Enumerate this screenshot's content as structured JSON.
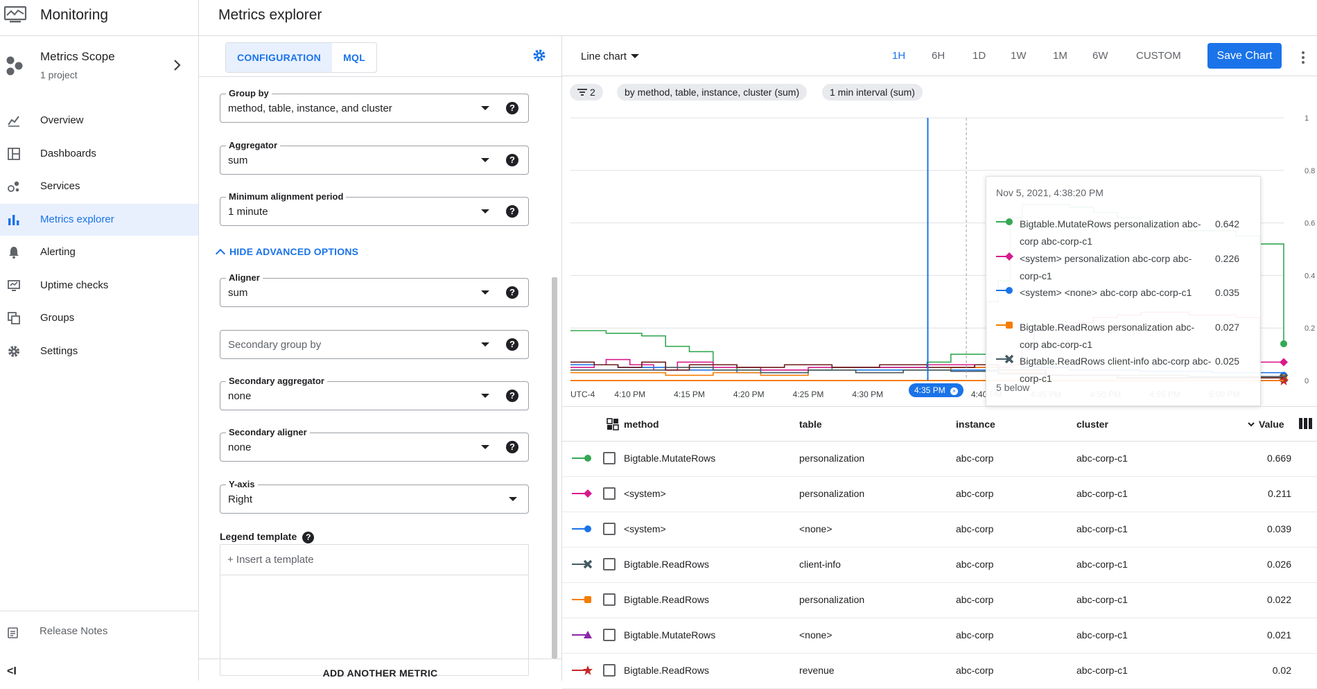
{
  "app": {
    "title": "Monitoring",
    "page_title": "Metrics explorer"
  },
  "scope": {
    "title": "Metrics Scope",
    "subtitle": "1 project"
  },
  "nav": {
    "items": [
      {
        "label": "Overview",
        "icon": "overview-icon"
      },
      {
        "label": "Dashboards",
        "icon": "dashboards-icon"
      },
      {
        "label": "Services",
        "icon": "services-icon"
      },
      {
        "label": "Metrics explorer",
        "icon": "metrics-explorer-icon",
        "active": true
      },
      {
        "label": "Alerting",
        "icon": "bell-icon"
      },
      {
        "label": "Uptime checks",
        "icon": "monitor-icon"
      },
      {
        "label": "Groups",
        "icon": "groups-icon"
      },
      {
        "label": "Settings",
        "icon": "gear-icon"
      }
    ],
    "release_notes": "Release Notes",
    "collapse": "<I"
  },
  "config": {
    "tabs": [
      {
        "label": "CONFIGURATION",
        "active": true
      },
      {
        "label": "MQL"
      }
    ],
    "group_by": {
      "label": "Group by",
      "value": "method, table, instance, and cluster"
    },
    "aggregator": {
      "label": "Aggregator",
      "value": "sum"
    },
    "min_alignment": {
      "label": "Minimum alignment period",
      "value": "1 minute"
    },
    "hide_advanced": "HIDE ADVANCED OPTIONS",
    "aligner": {
      "label": "Aligner",
      "value": "sum"
    },
    "secondary_group_by": {
      "placeholder": "Secondary group by"
    },
    "secondary_aggregator": {
      "label": "Secondary aggregator",
      "value": "none"
    },
    "secondary_aligner": {
      "label": "Secondary aligner",
      "value": "none"
    },
    "y_axis": {
      "label": "Y-axis",
      "value": "Right"
    },
    "legend_template": {
      "label": "Legend template",
      "placeholder": "+ Insert a template"
    },
    "add_metric": "ADD ANOTHER METRIC",
    "help_glyph": "?"
  },
  "toolbar": {
    "chart_type": "Line chart",
    "ranges": [
      {
        "label": "1H",
        "active": true
      },
      {
        "label": "6H"
      },
      {
        "label": "1D"
      },
      {
        "label": "1W"
      },
      {
        "label": "1M"
      },
      {
        "label": "6W"
      },
      {
        "label": "CUSTOM"
      }
    ],
    "save_label": "Save Chart"
  },
  "chips": {
    "filter_count": "2",
    "grouping": "by method, table, instance, cluster (sum)",
    "interval": "1 min interval (sum)"
  },
  "colors": {
    "green": "#34a853",
    "pink": "#d81b8c",
    "blue": "#1a73e8",
    "slate": "#455a64",
    "orange": "#f57c00",
    "purple": "#8e24aa",
    "red": "#c62828",
    "darkred": "#6d1b1b",
    "accent": "#1a73e8"
  },
  "chart_data": {
    "type": "line",
    "x": [
      "UTC-4",
      "4:10 PM",
      "4:15 PM",
      "4:20 PM",
      "4:25 PM",
      "4:30 PM",
      "4:35 PM",
      "4:40 PM",
      "4:45 PM",
      "4:50 PM",
      "4:55 PM",
      "5:00 PM"
    ],
    "x_start": "4:05 PM",
    "x_end": "5:05 PM",
    "yticks": [
      "0",
      "0.2",
      "0.4",
      "0.6",
      "0.8",
      "1"
    ],
    "ylim": [
      0,
      1
    ],
    "yaxis_side": "right",
    "cursor_time": "4:35 PM",
    "series": [
      {
        "name": "Bigtable.MutateRows personalization abc-corp abc-corp-c1",
        "color": "green",
        "marker": "circle",
        "points": [
          [
            0,
            0.19
          ],
          [
            3,
            0.18
          ],
          [
            5,
            0.18
          ],
          [
            6,
            0.17
          ],
          [
            8,
            0.13
          ],
          [
            10,
            0.11
          ],
          [
            12,
            0.06
          ],
          [
            14,
            0.04
          ],
          [
            18,
            0.04
          ],
          [
            22,
            0.05
          ],
          [
            25,
            0.05
          ],
          [
            28,
            0.05
          ],
          [
            30,
            0.07
          ],
          [
            32,
            0.1
          ],
          [
            34,
            0.1
          ],
          [
            35,
            0.3
          ],
          [
            36,
            0.38
          ],
          [
            37,
            0.62
          ],
          [
            38,
            0.67
          ],
          [
            42,
            0.66
          ],
          [
            44,
            0.64
          ],
          [
            46,
            0.62
          ],
          [
            48,
            0.6
          ],
          [
            52,
            0.57
          ],
          [
            56,
            0.55
          ],
          [
            58,
            0.52
          ],
          [
            60,
            0.14
          ]
        ]
      },
      {
        "name": "<system> personalization abc-corp abc-corp-c1",
        "color": "pink",
        "marker": "diamond",
        "points": [
          [
            0,
            0.05
          ],
          [
            2,
            0.06
          ],
          [
            3,
            0.08
          ],
          [
            5,
            0.06
          ],
          [
            7,
            0.04
          ],
          [
            9,
            0.07
          ],
          [
            12,
            0.05
          ],
          [
            16,
            0.04
          ],
          [
            20,
            0.05
          ],
          [
            26,
            0.05
          ],
          [
            30,
            0.06
          ],
          [
            34,
            0.05
          ],
          [
            37,
            0.06
          ],
          [
            38,
            0.12
          ],
          [
            39,
            0.19
          ],
          [
            40,
            0.2
          ],
          [
            42,
            0.22
          ],
          [
            44,
            0.24
          ],
          [
            46,
            0.25
          ],
          [
            48,
            0.26
          ],
          [
            52,
            0.25
          ],
          [
            56,
            0.24
          ],
          [
            58,
            0.07
          ],
          [
            60,
            0.07
          ]
        ]
      },
      {
        "name": "<system> <none> abc-corp abc-corp-c1",
        "color": "blue",
        "marker": "circle",
        "points": [
          [
            0,
            0.06
          ],
          [
            4,
            0.05
          ],
          [
            8,
            0.04
          ],
          [
            14,
            0.03
          ],
          [
            20,
            0.04
          ],
          [
            26,
            0.04
          ],
          [
            30,
            0.04
          ],
          [
            34,
            0.04
          ],
          [
            38,
            0.05
          ],
          [
            42,
            0.04
          ],
          [
            48,
            0.035
          ],
          [
            54,
            0.03
          ],
          [
            60,
            0.02
          ]
        ]
      },
      {
        "name": "Bigtable.ReadRows personalization abc-corp abc-corp-c1",
        "color": "orange",
        "marker": "square",
        "points": [
          [
            0,
            0.03
          ],
          [
            4,
            0.03
          ],
          [
            8,
            0.02
          ],
          [
            12,
            0.03
          ],
          [
            16,
            0.02
          ],
          [
            20,
            0.04
          ],
          [
            24,
            0.03
          ],
          [
            28,
            0.04
          ],
          [
            32,
            0.05
          ],
          [
            36,
            0.03
          ],
          [
            40,
            0.02
          ],
          [
            46,
            0.01
          ],
          [
            52,
            0.01
          ],
          [
            60,
            0.01
          ]
        ]
      },
      {
        "name": "Bigtable.ReadRows client-info abc-corp abc-corp-c1",
        "color": "slate",
        "marker": "cross",
        "points": [
          [
            0,
            0.04
          ],
          [
            4,
            0.04
          ],
          [
            8,
            0.05
          ],
          [
            12,
            0.04
          ],
          [
            16,
            0.03
          ],
          [
            20,
            0.04
          ],
          [
            24,
            0.03
          ],
          [
            28,
            0.04
          ],
          [
            32,
            0.035
          ],
          [
            36,
            0.025
          ],
          [
            40,
            0.02
          ],
          [
            46,
            0.02
          ],
          [
            52,
            0.015
          ],
          [
            60,
            0.01
          ]
        ]
      },
      {
        "name": "",
        "color": "darkred",
        "marker": "none",
        "points": [
          [
            0,
            0.07
          ],
          [
            2,
            0.06
          ],
          [
            4,
            0.05
          ],
          [
            6,
            0.07
          ],
          [
            8,
            0.04
          ],
          [
            10,
            0.06
          ],
          [
            14,
            0.05
          ],
          [
            18,
            0.06
          ],
          [
            22,
            0.05
          ],
          [
            26,
            0.06
          ],
          [
            30,
            0.05
          ],
          [
            34,
            0.06
          ],
          [
            36,
            0.04
          ],
          [
            40,
            0.02
          ],
          [
            46,
            0.01
          ],
          [
            60,
            0.005
          ]
        ]
      },
      {
        "name": "",
        "color": "red",
        "marker": "star",
        "points": [
          [
            0,
            0.0
          ],
          [
            20,
            0.0
          ],
          [
            40,
            0.0
          ],
          [
            60,
            0.0
          ]
        ]
      }
    ]
  },
  "tooltip": {
    "time": "Nov 5, 2021, 4:38:20 PM",
    "rows": [
      {
        "name": "Bigtable.MutateRows personalization abc-corp abc-corp-c1",
        "value": "0.642",
        "color": "green",
        "marker": "circle"
      },
      {
        "name": "<system> personalization abc-corp abc-corp-c1",
        "value": "0.226",
        "color": "pink",
        "marker": "diamond"
      },
      {
        "name": "<system> <none> abc-corp abc-corp-c1",
        "value": "0.035",
        "color": "blue",
        "marker": "circle"
      },
      {
        "name": "Bigtable.ReadRows personalization abc-corp abc-corp-c1",
        "value": "0.027",
        "color": "orange",
        "marker": "square"
      },
      {
        "name": "Bigtable.ReadRows client-info abc-corp abc-corp-c1",
        "value": "0.025",
        "color": "slate",
        "marker": "cross"
      }
    ],
    "below": "5 below"
  },
  "table": {
    "headers": {
      "method": "method",
      "table": "table",
      "instance": "instance",
      "cluster": "cluster",
      "value": "Value"
    },
    "rows": [
      {
        "method": "Bigtable.MutateRows",
        "table": "personalization",
        "instance": "abc-corp",
        "cluster": "abc-corp-c1",
        "value": "0.669",
        "color": "green",
        "marker": "circle"
      },
      {
        "method": "<system>",
        "table": "personalization",
        "instance": "abc-corp",
        "cluster": "abc-corp-c1",
        "value": "0.211",
        "color": "pink",
        "marker": "diamond"
      },
      {
        "method": "<system>",
        "table": "<none>",
        "instance": "abc-corp",
        "cluster": "abc-corp-c1",
        "value": "0.039",
        "color": "blue",
        "marker": "circle"
      },
      {
        "method": "Bigtable.ReadRows",
        "table": "client-info",
        "instance": "abc-corp",
        "cluster": "abc-corp-c1",
        "value": "0.026",
        "color": "slate",
        "marker": "cross"
      },
      {
        "method": "Bigtable.ReadRows",
        "table": "personalization",
        "instance": "abc-corp",
        "cluster": "abc-corp-c1",
        "value": "0.022",
        "color": "orange",
        "marker": "square"
      },
      {
        "method": "Bigtable.MutateRows",
        "table": "<none>",
        "instance": "abc-corp",
        "cluster": "abc-corp-c1",
        "value": "0.021",
        "color": "purple",
        "marker": "triangle"
      },
      {
        "method": "Bigtable.ReadRows",
        "table": "revenue",
        "instance": "abc-corp",
        "cluster": "abc-corp-c1",
        "value": "0.02",
        "color": "red",
        "marker": "star"
      }
    ]
  }
}
